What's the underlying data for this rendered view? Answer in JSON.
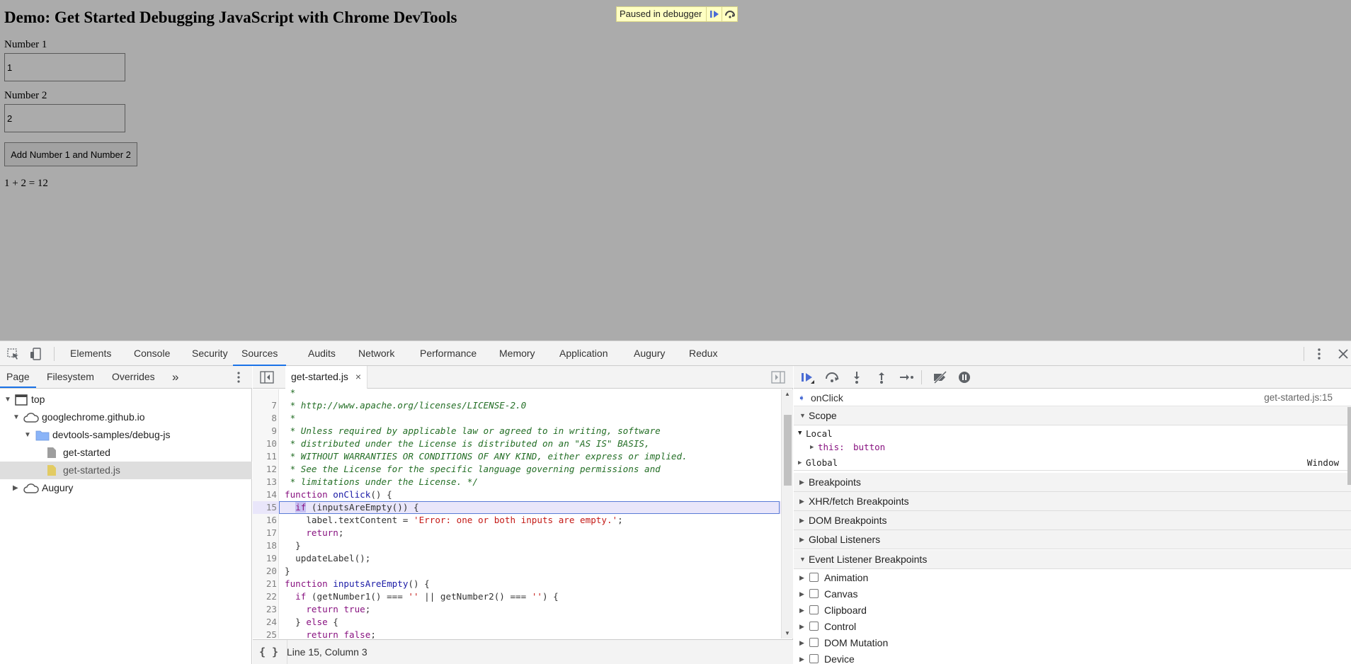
{
  "page": {
    "heading": "Demo: Get Started Debugging JavaScript with Chrome DevTools",
    "number1_label": "Number 1",
    "number1_value": "1",
    "number2_label": "Number 2",
    "number2_value": "2",
    "add_button": "Add Number 1 and Number 2",
    "result": "1 + 2 = 12",
    "paused_text": "Paused in debugger"
  },
  "devtools": {
    "tabs": [
      "Elements",
      "Console",
      "Security",
      "Sources",
      "Audits",
      "Network",
      "Performance",
      "Memory",
      "Application",
      "Augury",
      "Redux"
    ],
    "active_tab": "Sources",
    "navigator": {
      "subtabs": [
        "Page",
        "Filesystem",
        "Overrides"
      ],
      "more": "»",
      "tree": {
        "top": "top",
        "origin": "googlechrome.github.io",
        "folder": "devtools-samples/debug-js",
        "file1": "get-started",
        "file2": "get-started.js",
        "augury": "Augury"
      }
    },
    "editor": {
      "file_tab": "get-started.js",
      "close": "×",
      "lines": [
        {
          "n": "",
          "text": " *",
          "cls": "cmt"
        },
        {
          "n": "7",
          "text": " * http://www.apache.org/licenses/LICENSE-2.0",
          "cls": "cmt"
        },
        {
          "n": "8",
          "text": " *",
          "cls": "cmt"
        },
        {
          "n": "9",
          "text": " * Unless required by applicable law or agreed to in writing, software",
          "cls": "cmt"
        },
        {
          "n": "10",
          "text": " * distributed under the License is distributed on an \"AS IS\" BASIS,",
          "cls": "cmt"
        },
        {
          "n": "11",
          "text": " * WITHOUT WARRANTIES OR CONDITIONS OF ANY KIND, either express or implied.",
          "cls": "cmt"
        },
        {
          "n": "12",
          "text": " * See the License for the specific language governing permissions and",
          "cls": "cmt"
        },
        {
          "n": "13",
          "text": " * limitations under the License. */",
          "cls": "cmt"
        },
        {
          "n": "14",
          "text": "function onClick() {",
          "cls": "fnline"
        },
        {
          "n": "15",
          "text": "  if (inputsAreEmpty()) {",
          "cls": "exec"
        },
        {
          "n": "16",
          "text": "    label.textContent = 'Error: one or both inputs are empty.';",
          "cls": "strline"
        },
        {
          "n": "17",
          "text": "    return;",
          "cls": "plain"
        },
        {
          "n": "18",
          "text": "  }",
          "cls": "plain"
        },
        {
          "n": "19",
          "text": "  updateLabel();",
          "cls": "plain"
        },
        {
          "n": "20",
          "text": "}",
          "cls": "plain"
        },
        {
          "n": "21",
          "text": "function inputsAreEmpty() {",
          "cls": "fnline"
        },
        {
          "n": "22",
          "text": "  if (getNumber1() === '' || getNumber2() === '') {",
          "cls": "ifline"
        },
        {
          "n": "23",
          "text": "    return true;",
          "cls": "plain"
        },
        {
          "n": "24",
          "text": "  } else {",
          "cls": "plain"
        },
        {
          "n": "25",
          "text": "    return false;",
          "cls": "plain"
        }
      ],
      "status": "Line 15, Column 3",
      "pretty": "{ }"
    },
    "debugger": {
      "call_frame": "onClick",
      "call_location": "get-started.js:15",
      "scope_title": "Scope",
      "local_title": "Local",
      "this_key": "this:",
      "this_val": "button",
      "global_title": "Global",
      "global_val": "Window",
      "sections": [
        "Breakpoints",
        "XHR/fetch Breakpoints",
        "DOM Breakpoints",
        "Global Listeners",
        "Event Listener Breakpoints"
      ],
      "event_categories": [
        "Animation",
        "Canvas",
        "Clipboard",
        "Control",
        "DOM Mutation",
        "Device"
      ]
    }
  }
}
